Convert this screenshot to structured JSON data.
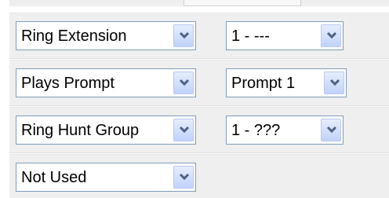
{
  "rows": [
    {
      "type": "Ring Extension",
      "target": "1 - ---"
    },
    {
      "type": "Plays Prompt",
      "target": "Prompt 1"
    },
    {
      "type": "Ring Hunt Group",
      "target": "1 - ???"
    },
    {
      "type": "Not Used"
    }
  ],
  "dropdown_icon": "chevron-down-icon",
  "colors": {
    "row_background": "#efefef",
    "select_border": "#7f9db9",
    "button_gradient_top": "#e6eefc",
    "button_gradient_bottom": "#c1d3fb",
    "chevron": "#4d6185"
  }
}
